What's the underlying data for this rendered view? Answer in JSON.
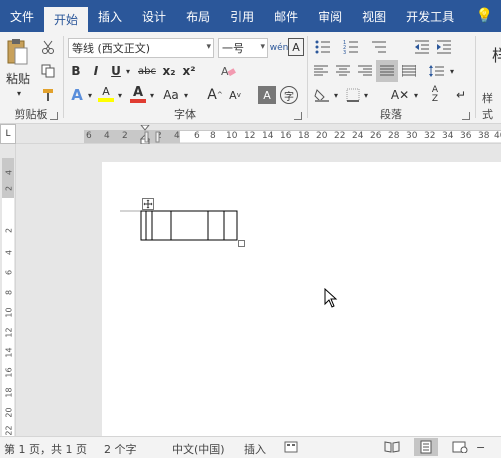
{
  "tabs": [
    {
      "label": "文件"
    },
    {
      "label": "开始"
    },
    {
      "label": "插入"
    },
    {
      "label": "设计"
    },
    {
      "label": "布局"
    },
    {
      "label": "引用"
    },
    {
      "label": "邮件"
    },
    {
      "label": "审阅"
    },
    {
      "label": "视图"
    },
    {
      "label": "开发工具"
    }
  ],
  "active_tab": "开始",
  "clipboard": {
    "paste_label": "粘贴",
    "group_label": "剪贴板"
  },
  "font": {
    "name": "等线 (西文正文)",
    "size": "一号",
    "group_label": "字体",
    "bold": "B",
    "italic": "I",
    "underline": "U",
    "strike": "abc",
    "subscript": "x₂",
    "superscript": "x²",
    "change_case": "Aa",
    "grow": "A",
    "shrink": "A",
    "clear": "A",
    "phonetic": "文",
    "enclose": "字",
    "highlight_letter": "A",
    "color_letter": "A"
  },
  "paragraph": {
    "group_label": "段落"
  },
  "styles": {
    "group_label": "样式",
    "preview": "样"
  },
  "ruler_top_ticks": [
    "6",
    "4",
    "2",
    "2",
    "4",
    "6",
    "8",
    "10",
    "12",
    "14",
    "16",
    "18",
    "20",
    "22",
    "24",
    "26",
    "28",
    "30",
    "32",
    "34",
    "36",
    "38",
    "40"
  ],
  "ruler_left_ticks": [
    "4",
    "2",
    "2",
    "4",
    "6",
    "8",
    "10",
    "12",
    "14",
    "16",
    "18",
    "20",
    "22"
  ],
  "status": {
    "page": "第 1 页，共 1 页",
    "words": "2 个字",
    "language": "中文(中国)",
    "mode": "插入"
  },
  "colors": {
    "ribbon_blue": "#2b579a",
    "highlight": "#ffff00",
    "font_red": "#e03c31"
  }
}
